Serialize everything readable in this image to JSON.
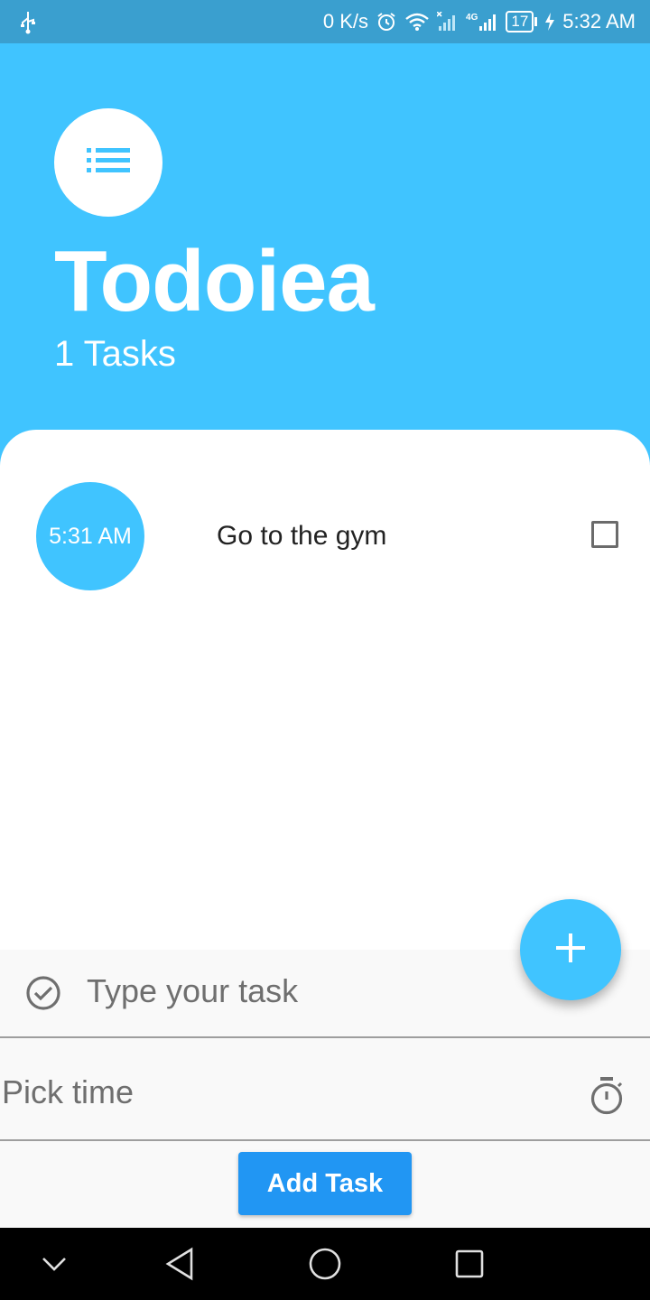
{
  "status_bar": {
    "network_speed": "0 K/s",
    "network_type": "4G",
    "battery_level": "17",
    "time": "5:32 AM",
    "icons": [
      "usb-icon",
      "alarm-icon",
      "wifi-icon",
      "signal-icon",
      "signal-4g-icon",
      "battery-icon",
      "charging-icon"
    ]
  },
  "header": {
    "app_icon": "list-icon",
    "title": "Todoiea",
    "task_count": "1 Tasks"
  },
  "tasks": [
    {
      "time": "5:31 AM",
      "title": "Go to the gym",
      "done": false
    }
  ],
  "form": {
    "task_placeholder": "Type your task",
    "pick_time_label": "Pick time",
    "add_button_label": "Add Task"
  },
  "colors": {
    "primary": "#40c4ff",
    "status_bar": "#3a9fcf",
    "button": "#2196f3"
  }
}
